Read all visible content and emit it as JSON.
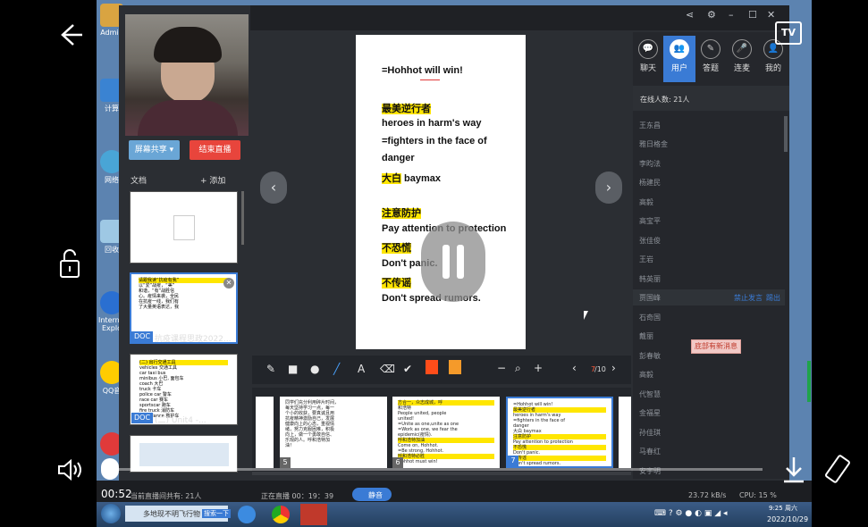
{
  "desktop": {
    "icons": [
      {
        "label": "Admin",
        "color": "#d9a441"
      },
      {
        "label": "计算",
        "color": "#3a83d2"
      },
      {
        "label": "网络",
        "color": "#49a5d6"
      },
      {
        "label": "回收",
        "color": "#9ec8e4"
      },
      {
        "label": "Internet Explo",
        "color": "#2a6fd1"
      },
      {
        "label": "QQ音",
        "color": "#ffcc00"
      },
      {
        "label": "",
        "color": "#e03a3a"
      }
    ]
  },
  "video_overlay": {
    "tv_label": "TV",
    "time": "00:52"
  },
  "sidebar": {
    "share_button": "屏幕共享 ▾",
    "end_button": "结束直播",
    "docs_label": "文档",
    "add_label": "+ 添加",
    "docs": [
      {
        "badge": "",
        "name": ""
      },
      {
        "badge": "DOC",
        "name": "抗疫课程思政2022..."
      },
      {
        "badge": "DOC",
        "name": "(二) Unit4 -..."
      },
      {
        "badge": "",
        "name": ""
      }
    ],
    "doc1_preview": [
      "请跟我读“抗疫有我”",
      "以“爱”战疫，“美”",
      "和谐，“有”战胜信",
      "心。疫情来袭，全民",
      "在抗疫一线，我们有",
      "了大量英语表达，我"
    ],
    "doc2_preview": [
      "(二) 出行交通工具",
      "vehicles 交通工具",
      "car taxi bus",
      "minibus 小巴, 面包车",
      "coach 大巴",
      "truck 卡车",
      "police car 警车",
      "race car 赛车",
      "sportscar 跑车",
      "fire truck 消防车",
      "ambulance 救护车"
    ]
  },
  "slide": {
    "lines": [
      {
        "text": "=Hohhot will win!",
        "highlight": false
      },
      {
        "text": "最美逆行者",
        "highlight": true
      },
      {
        "text": "heroes in harm's way",
        "highlight": false
      },
      {
        "text": "=fighters  in  the  face  of",
        "highlight": false
      },
      {
        "text": "danger",
        "highlight": false
      },
      {
        "text": "大白",
        "highlight": true,
        "suffix": " baymax"
      },
      {
        "text": "注意防护",
        "highlight": true
      },
      {
        "text": "Pay attention to protection",
        "highlight": false
      },
      {
        "text": "不恐慌",
        "highlight": true
      },
      {
        "text": "Don't panic.",
        "highlight": false
      },
      {
        "text": "不传谣",
        "highlight": true
      },
      {
        "text": "Don't spread rumors.",
        "highlight": false
      }
    ],
    "prev_arrow": "‹",
    "next_arrow": "›",
    "pause_icon": "pause-icon"
  },
  "toolbar": {
    "tools": [
      "✎",
      "■",
      "●",
      "╱",
      "A",
      "⌫",
      "✔"
    ],
    "colors": [
      "#ff4d1a",
      "#f59a2a"
    ],
    "zoom_out": "−",
    "zoom_icon": "⌕",
    "zoom_in": "+",
    "page_prev": "‹",
    "page_current": "7",
    "page_total": "/10",
    "page_next": "›"
  },
  "strip": {
    "pages": [
      {
        "num": "5",
        "text": [
          "同学们充分利用碎片时间，",
          "每天坚持学习一点，每一",
          "个小的收获，要真诚且用",
          "抗疫精神激励自己，发展",
          "健康向上的心态，重视情",
          "绪，努力克服困难，积极",
          "向上，做一个勇敢自信、",
          "乐观的人。呼和浩特加",
          "油！"
        ]
      },
      {
        "num": "6",
        "text": [
          "方合一，众志成城，呼",
          "和浩特",
          "People united, people",
          "united!",
          "=Unite as one,unite as one",
          "=Work as one, we fear the",
          "epidemic(疫情).",
          "呼和浩特加油",
          "Come on, Hohhot.",
          "=Be strong, Hohhot.",
          "呼和浩特必胜",
          "Hohhot must win!"
        ]
      },
      {
        "num": "7",
        "text": [
          "=Hohhot will win!",
          "最美逆行者",
          "heroes in harm's way",
          "=fighters in the face of",
          "danger",
          "大白 baymax",
          "注意防护",
          "Pay attention to protection",
          "不恐慌",
          "Don't panic.",
          "不传谣",
          "Don't spread rumors."
        ]
      }
    ]
  },
  "right_panel": {
    "tabs": [
      {
        "label": "聊天",
        "icon": "chat-icon",
        "glyph": "💬"
      },
      {
        "label": "用户",
        "icon": "users-icon",
        "glyph": "👥"
      },
      {
        "label": "答题",
        "icon": "pen-icon",
        "glyph": "✎"
      },
      {
        "label": "连麦",
        "icon": "mic-icon",
        "glyph": "🎤"
      },
      {
        "label": "我的",
        "icon": "profile-icon",
        "glyph": "👤"
      }
    ],
    "online_count": "在线人数: 21人",
    "users": [
      "王东昌",
      "雅日格金",
      "李昀法",
      "杨建民",
      "高毅",
      "高宝平",
      "张佳俊",
      "王岩",
      "韩英丽",
      "贾国峰",
      "石奇国",
      "戴丽",
      "彭春敏",
      "高毅",
      "代智慧",
      "金福星",
      "孙佳琪",
      "马春红",
      "安宇明"
    ],
    "row_actions": {
      "mute": "禁止发言",
      "kick": "踢出"
    },
    "new_message": "底部有新消息"
  },
  "status_bar": {
    "viewers": "当前直播间共有: 21人",
    "live_time": "正在直播 00：19：39",
    "mute_button": "静音",
    "bandwidth": "23.72 kB/s",
    "cpu": "CPU: 15 %"
  },
  "taskbar": {
    "task_label": "多地现不明飞行物",
    "search_label": "搜索一下",
    "clock_time": "9:25 周六",
    "clock_date": "2022/10/29"
  },
  "colors": {
    "accent": "#3a7bd5",
    "end_button": "#e8453c",
    "highlight": "#ffe600"
  }
}
